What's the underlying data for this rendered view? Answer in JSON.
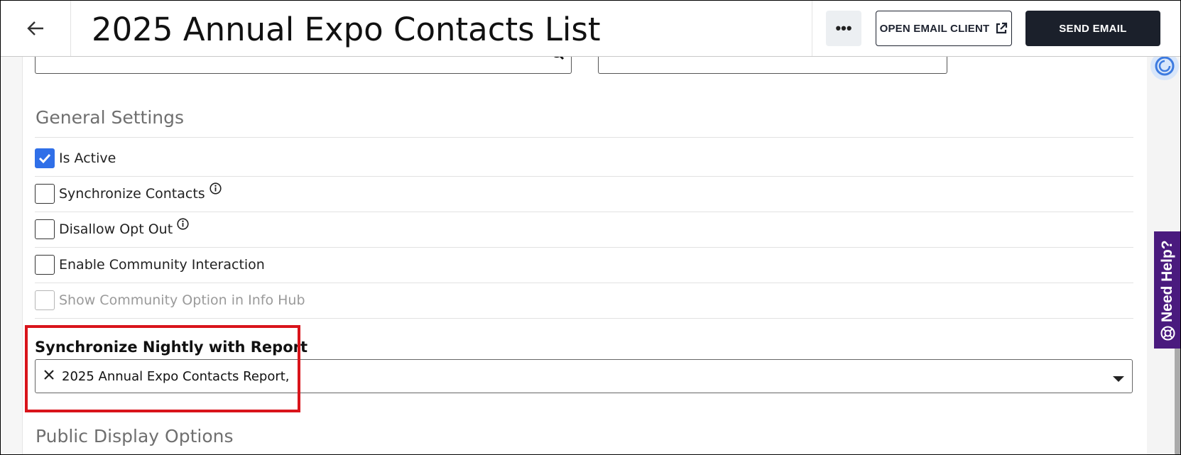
{
  "header": {
    "title": "2025 Annual Expo Contacts List",
    "more_label": "•••",
    "open_email_label": "OPEN EMAIL CLIENT",
    "send_email_label": "SEND EMAIL"
  },
  "sections": {
    "general_settings": "General Settings",
    "public_display": "Public Display Options"
  },
  "checkboxes": [
    {
      "label": "Is Active",
      "checked": true,
      "disabled": false,
      "info": false
    },
    {
      "label": "Synchronize Contacts",
      "checked": false,
      "disabled": false,
      "info": true
    },
    {
      "label": "Disallow Opt Out",
      "checked": false,
      "disabled": false,
      "info": true
    },
    {
      "label": "Enable Community Interaction",
      "checked": false,
      "disabled": false,
      "info": false
    },
    {
      "label": "Show Community Option in Info Hub",
      "checked": false,
      "disabled": true,
      "info": false
    }
  ],
  "sync_report": {
    "label": "Synchronize Nightly with Report",
    "value": "2025 Annual Expo Contacts Report,"
  },
  "help_tab": {
    "label": "Need Help?"
  },
  "colors": {
    "accent": "#2f6fe8",
    "primary_button": "#1b202b",
    "help_tab": "#4a1a7e",
    "highlight": "#d9141b"
  }
}
